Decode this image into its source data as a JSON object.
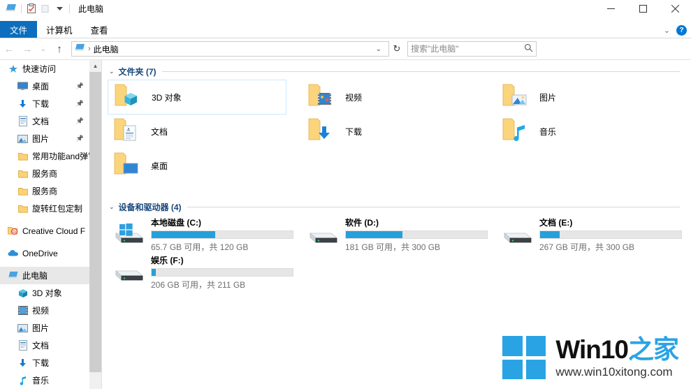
{
  "window": {
    "title": "此电脑",
    "quick_access_icons": [
      "this-pc-icon",
      "properties-icon",
      "new-folder-icon",
      "customize-dropdown-icon"
    ],
    "controls": {
      "minimize": "—",
      "maximize": "□",
      "close": "✕"
    }
  },
  "ribbon": {
    "tabs": [
      {
        "label": "文件",
        "active": true
      },
      {
        "label": "计算机",
        "active": false
      },
      {
        "label": "查看",
        "active": false
      }
    ],
    "collapse_chevron": "⌄",
    "help_label": "?"
  },
  "addressbar": {
    "back": "←",
    "forward": "→",
    "recent": "⌄",
    "up": "↑",
    "crumb_icon": "this-pc-icon",
    "crumb_sep": "›",
    "crumb": "此电脑",
    "dropdown": "⌄",
    "refresh": "↻"
  },
  "search": {
    "placeholder": "搜索\"此电脑\"",
    "value": "",
    "icon": "⌕"
  },
  "sidebar": {
    "items": [
      {
        "label": "快速访问",
        "icon": "star-pin-icon",
        "indent": 0,
        "pinned": false,
        "selected": false
      },
      {
        "label": "桌面",
        "icon": "desktop-icon",
        "indent": 1,
        "pinned": true,
        "selected": false
      },
      {
        "label": "下载",
        "icon": "downloads-icon",
        "indent": 1,
        "pinned": true,
        "selected": false
      },
      {
        "label": "文档",
        "icon": "documents-icon",
        "indent": 1,
        "pinned": true,
        "selected": false
      },
      {
        "label": "图片",
        "icon": "pictures-icon",
        "indent": 1,
        "pinned": true,
        "selected": false
      },
      {
        "label": "常用功能and弹窗",
        "icon": "folder-icon",
        "indent": 1,
        "pinned": false,
        "selected": false
      },
      {
        "label": "服务商",
        "icon": "folder-icon",
        "indent": 1,
        "pinned": false,
        "selected": false
      },
      {
        "label": "服务商",
        "icon": "folder-icon",
        "indent": 1,
        "pinned": false,
        "selected": false
      },
      {
        "label": "旋转红包定制",
        "icon": "folder-icon",
        "indent": 1,
        "pinned": false,
        "selected": false
      },
      {
        "label": "Creative Cloud F",
        "icon": "creative-cloud-icon",
        "indent": 0,
        "pinned": false,
        "selected": false
      },
      {
        "label": "OneDrive",
        "icon": "onedrive-icon",
        "indent": 0,
        "pinned": false,
        "selected": false
      },
      {
        "label": "此电脑",
        "icon": "this-pc-icon",
        "indent": 0,
        "pinned": false,
        "selected": true
      },
      {
        "label": "3D 对象",
        "icon": "3d-objects-icon",
        "indent": 1,
        "pinned": false,
        "selected": false
      },
      {
        "label": "视频",
        "icon": "videos-icon",
        "indent": 1,
        "pinned": false,
        "selected": false
      },
      {
        "label": "图片",
        "icon": "pictures-icon",
        "indent": 1,
        "pinned": false,
        "selected": false
      },
      {
        "label": "文档",
        "icon": "documents-icon",
        "indent": 1,
        "pinned": false,
        "selected": false
      },
      {
        "label": "下载",
        "icon": "downloads-icon",
        "indent": 1,
        "pinned": false,
        "selected": false
      },
      {
        "label": "音乐",
        "icon": "music-icon",
        "indent": 1,
        "pinned": false,
        "selected": false
      }
    ]
  },
  "content": {
    "groups": [
      {
        "title": "文件夹 (7)",
        "chevron": "⌄"
      },
      {
        "title": "设备和驱动器 (4)",
        "chevron": "⌄"
      }
    ],
    "folders": [
      {
        "label": "3D 对象",
        "icon": "3d-objects-folder-icon",
        "selected": true,
        "col": 0,
        "row": 0
      },
      {
        "label": "视频",
        "icon": "videos-folder-icon",
        "selected": false,
        "col": 1,
        "row": 0
      },
      {
        "label": "图片",
        "icon": "pictures-folder-icon",
        "selected": false,
        "col": 2,
        "row": 0
      },
      {
        "label": "文档",
        "icon": "documents-folder-icon",
        "selected": false,
        "col": 0,
        "row": 1
      },
      {
        "label": "下载",
        "icon": "downloads-folder-icon",
        "selected": false,
        "col": 1,
        "row": 1
      },
      {
        "label": "音乐",
        "icon": "music-folder-icon",
        "selected": false,
        "col": 2,
        "row": 1
      },
      {
        "label": "桌面",
        "icon": "desktop-folder-icon",
        "selected": false,
        "col": 0,
        "row": 2
      }
    ],
    "drives": [
      {
        "name": "本地磁盘 (C:)",
        "capacity_text": "65.7 GB 可用，共 120 GB",
        "used_percent": 45,
        "icon": "windows-drive-icon",
        "col": 0,
        "row": 0
      },
      {
        "name": "软件 (D:)",
        "capacity_text": "181 GB 可用，共 300 GB",
        "used_percent": 40,
        "icon": "drive-icon",
        "col": 1,
        "row": 0
      },
      {
        "name": "文档 (E:)",
        "capacity_text": "267 GB 可用，共 300 GB",
        "used_percent": 14,
        "icon": "drive-icon",
        "col": 2,
        "row": 0
      },
      {
        "name": "娱乐 (F:)",
        "capacity_text": "206 GB 可用，共 211 GB",
        "used_percent": 3,
        "icon": "drive-icon",
        "col": 0,
        "row": 1
      }
    ]
  },
  "watermark": {
    "brand_main": "Win10",
    "brand_sub": "之家",
    "url": "www.win10xitong.com"
  },
  "colors": {
    "accent": "#0c6ebd",
    "bar_fill": "#26a0da",
    "group_title": "#16467b",
    "selection_border": "#cce8ff",
    "watermark_blue": "#2aa3e5"
  }
}
